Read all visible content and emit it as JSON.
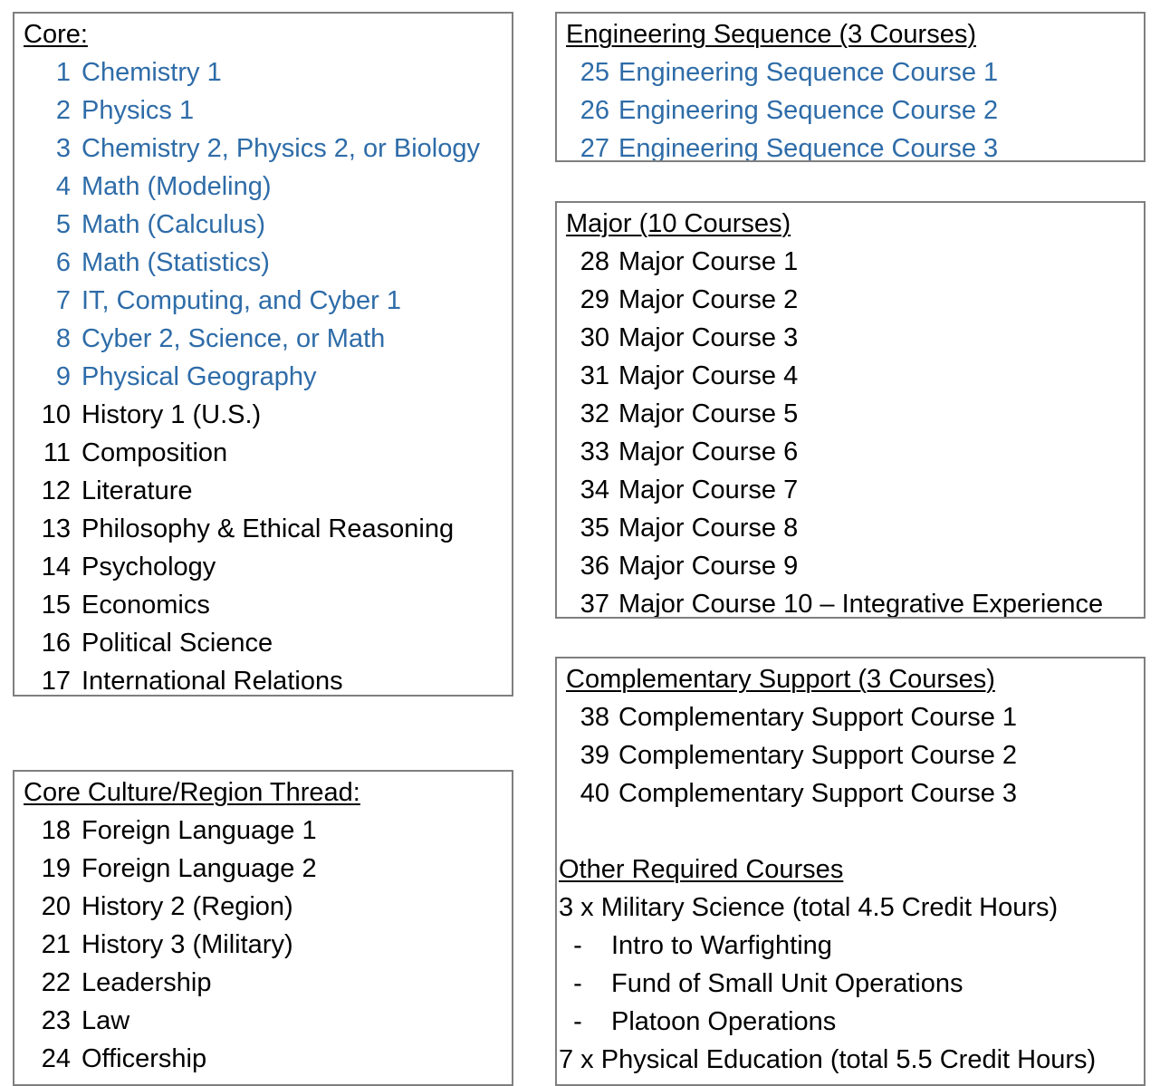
{
  "colors": {
    "blue": "#2E6CA8",
    "black": "#000000",
    "box_border": "#7f7f7f",
    "background": "#ffffff"
  },
  "core": {
    "heading": "Core:",
    "items": [
      {
        "num": "1",
        "title": "Chemistry 1",
        "color": "blue"
      },
      {
        "num": "2",
        "title": "Physics 1",
        "color": "blue"
      },
      {
        "num": "3",
        "title": "Chemistry 2, Physics 2, or Biology",
        "color": "blue"
      },
      {
        "num": "4",
        "title": "Math (Modeling)",
        "color": "blue"
      },
      {
        "num": "5",
        "title": "Math (Calculus)",
        "color": "blue"
      },
      {
        "num": "6",
        "title": "Math (Statistics)",
        "color": "blue"
      },
      {
        "num": "7",
        "title": "IT, Computing, and Cyber 1",
        "color": "blue"
      },
      {
        "num": "8",
        "title": "Cyber 2, Science, or Math",
        "color": "blue"
      },
      {
        "num": "9",
        "title": "Physical Geography",
        "color": "blue"
      },
      {
        "num": "10",
        "title": "History 1 (U.S.)",
        "color": "black"
      },
      {
        "num": "11",
        "title": "Composition",
        "color": "black"
      },
      {
        "num": "12",
        "title": "Literature",
        "color": "black"
      },
      {
        "num": "13",
        "title": "Philosophy & Ethical Reasoning",
        "color": "black"
      },
      {
        "num": "14",
        "title": "Psychology",
        "color": "black"
      },
      {
        "num": "15",
        "title": "Economics",
        "color": "black"
      },
      {
        "num": "16",
        "title": "Political Science",
        "color": "black"
      },
      {
        "num": "17",
        "title": "International Relations",
        "color": "black"
      }
    ]
  },
  "culture": {
    "heading": "Core Culture/Region Thread:",
    "items": [
      {
        "num": "18",
        "title": "Foreign Language 1",
        "color": "black"
      },
      {
        "num": "19",
        "title": "Foreign Language 2",
        "color": "black"
      },
      {
        "num": "20",
        "title": "History 2 (Region)",
        "color": "black"
      },
      {
        "num": "21",
        "title": "History 3 (Military)",
        "color": "black"
      },
      {
        "num": "22",
        "title": "Leadership",
        "color": "black"
      },
      {
        "num": "23",
        "title": "Law",
        "color": "black"
      },
      {
        "num": "24",
        "title": "Officership",
        "color": "black"
      }
    ]
  },
  "engineering": {
    "heading": "Engineering Sequence (3 Courses)",
    "items": [
      {
        "num": "25",
        "title": "Engineering Sequence Course 1",
        "color": "blue"
      },
      {
        "num": "26",
        "title": "Engineering Sequence Course 2",
        "color": "blue"
      },
      {
        "num": "27",
        "title": "Engineering Sequence Course 3",
        "color": "blue"
      }
    ]
  },
  "major": {
    "heading": "Major (10 Courses)",
    "items": [
      {
        "num": "28",
        "title": "Major Course 1",
        "color": "black"
      },
      {
        "num": "29",
        "title": "Major Course 2",
        "color": "black"
      },
      {
        "num": "30",
        "title": "Major Course 3",
        "color": "black"
      },
      {
        "num": "31",
        "title": "Major Course 4",
        "color": "black"
      },
      {
        "num": "32",
        "title": "Major Course 5",
        "color": "black"
      },
      {
        "num": "33",
        "title": "Major Course 6",
        "color": "black"
      },
      {
        "num": "34",
        "title": "Major Course 7",
        "color": "black"
      },
      {
        "num": "35",
        "title": "Major Course 8",
        "color": "black"
      },
      {
        "num": "36",
        "title": "Major Course 9",
        "color": "black"
      },
      {
        "num": "37",
        "title": "Major Course 10 – Integrative Experience",
        "color": "black"
      }
    ]
  },
  "support": {
    "heading": "Complementary Support (3 Courses)",
    "items": [
      {
        "num": "38",
        "title": "Complementary Support Course 1",
        "color": "black"
      },
      {
        "num": "39",
        "title": "Complementary Support Course 2",
        "color": "black"
      },
      {
        "num": "40",
        "title": "Complementary Support Course 3",
        "color": "black"
      }
    ],
    "other": {
      "heading": "Other Required Courses",
      "military_science_line": "3 x Military Science (total 4.5 Credit Hours)",
      "military_science_items": [
        {
          "dash": "-",
          "title": "Intro to Warfighting"
        },
        {
          "dash": "-",
          "title": "Fund of Small Unit Operations"
        },
        {
          "dash": "-",
          "title": "Platoon Operations"
        }
      ],
      "physical_education_line": "7 x Physical Education (total 5.5 Credit Hours)"
    }
  }
}
